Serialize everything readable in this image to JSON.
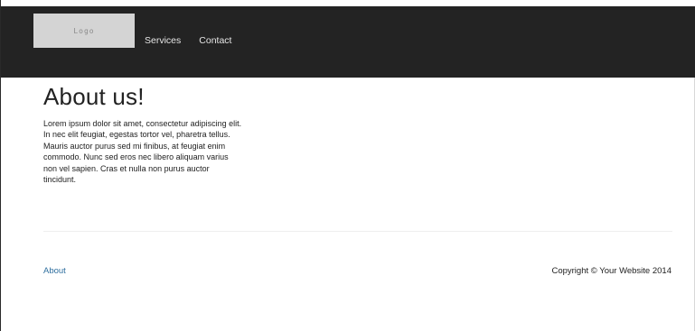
{
  "header": {
    "logo_text": "Logo",
    "nav": {
      "services": "Services",
      "contact": "Contact"
    }
  },
  "main": {
    "heading": "About us!",
    "body": "Lorem ipsum dolor sit amet, consectetur adipiscing elit. In nec elit feugiat, egestas tortor vel, pharetra tellus. Mauris auctor purus sed mi finibus, at feugiat enim commodo. Nunc sed eros nec libero aliquam varius non vel sapien. Cras et nulla non purus auctor tincidunt."
  },
  "footer": {
    "about_link": "About",
    "copyright": "Copyright © Your Website 2014"
  },
  "colors": {
    "header_bg": "#232323",
    "link": "#2f6f9f",
    "logo_bg": "#d4d4d4"
  }
}
